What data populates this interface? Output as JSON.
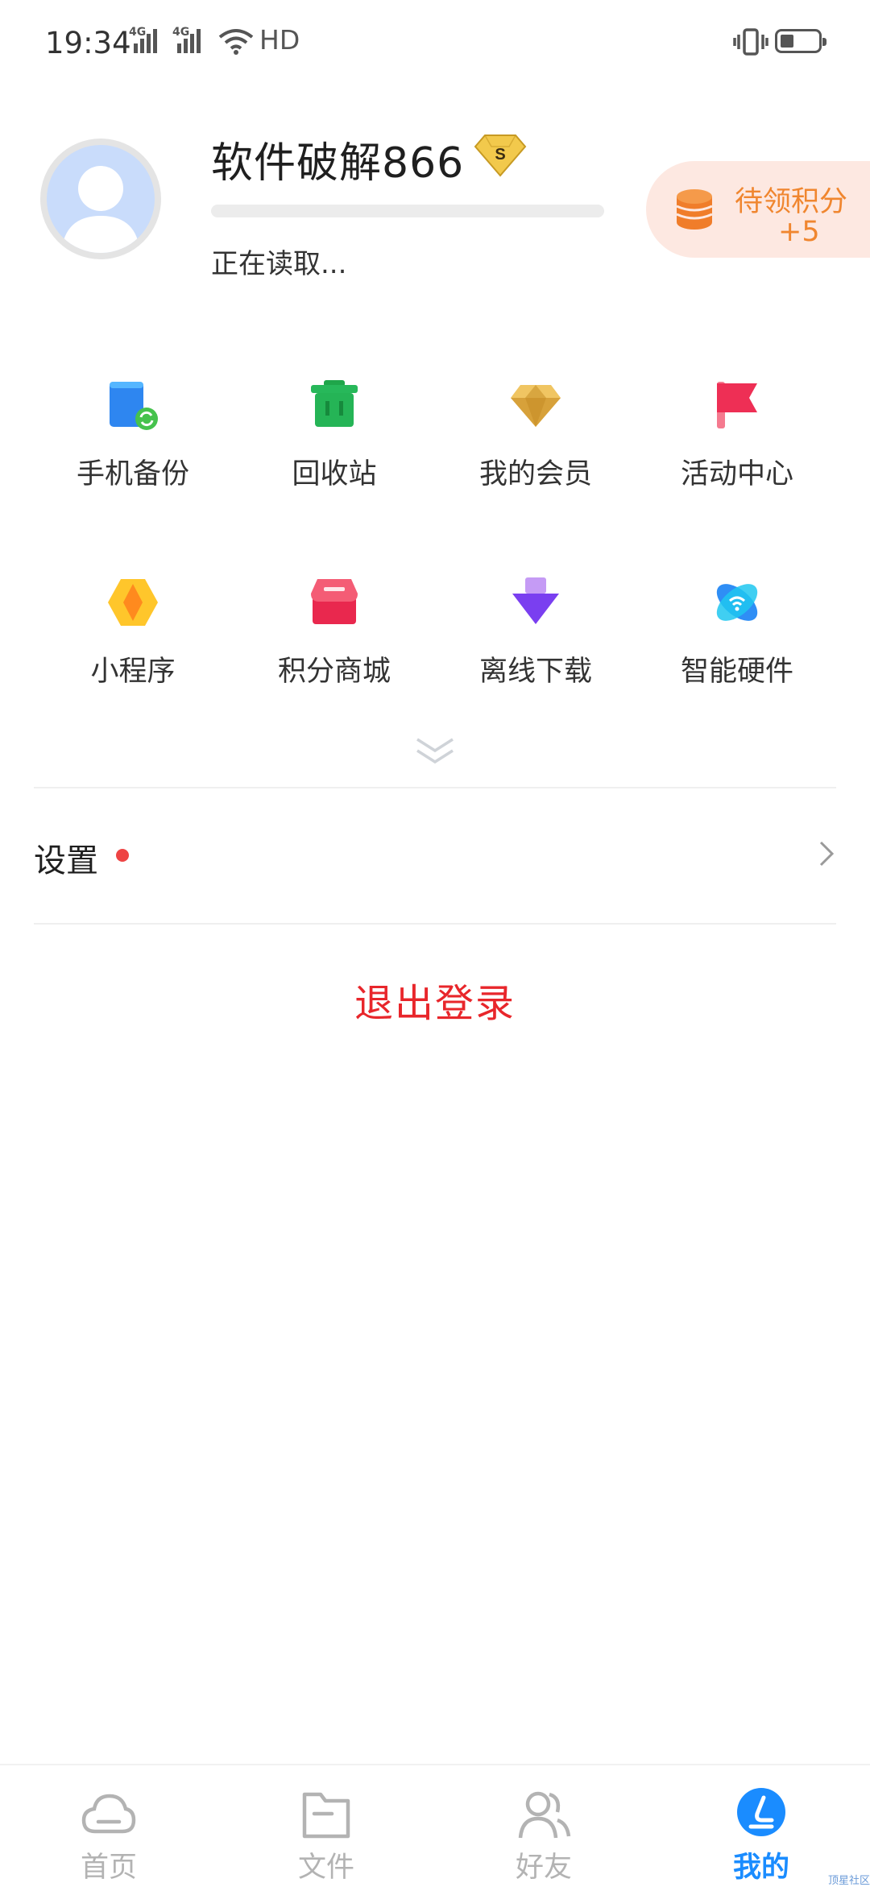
{
  "status_bar": {
    "time": "19:34",
    "signal1_label": "4G",
    "signal2_label": "4G",
    "hd_label": "HD",
    "icons": [
      "signal-icon",
      "signal-icon",
      "wifi-icon",
      "vibrate-icon",
      "battery-icon"
    ]
  },
  "profile": {
    "username": "软件破解866",
    "status": "正在读取...",
    "vip_badge_letter": "S"
  },
  "points": {
    "title": "待领积分",
    "value": "+5"
  },
  "grid": {
    "items": [
      {
        "label": "手机备份",
        "icon": "phone-backup-icon"
      },
      {
        "label": "回收站",
        "icon": "recycle-bin-icon"
      },
      {
        "label": "我的会员",
        "icon": "diamond-icon"
      },
      {
        "label": "活动中心",
        "icon": "flag-icon"
      },
      {
        "label": "小程序",
        "icon": "mini-program-icon"
      },
      {
        "label": "积分商城",
        "icon": "shop-icon"
      },
      {
        "label": "离线下载",
        "icon": "offline-download-icon"
      },
      {
        "label": "智能硬件",
        "icon": "smart-hardware-icon"
      }
    ]
  },
  "settings": {
    "label": "设置"
  },
  "logout": {
    "label": "退出登录"
  },
  "bottom_nav": {
    "items": [
      {
        "label": "首页",
        "icon": "cloud-icon",
        "active": false
      },
      {
        "label": "文件",
        "icon": "folder-icon",
        "active": false
      },
      {
        "label": "好友",
        "icon": "friends-icon",
        "active": false
      },
      {
        "label": "我的",
        "icon": "profile-icon",
        "active": true
      }
    ]
  },
  "watermark": "顶星社区",
  "colors": {
    "accent": "#1a8cff",
    "logout": "#e8262b",
    "points": "#f0862f",
    "points_bg": "#fde8e1"
  }
}
